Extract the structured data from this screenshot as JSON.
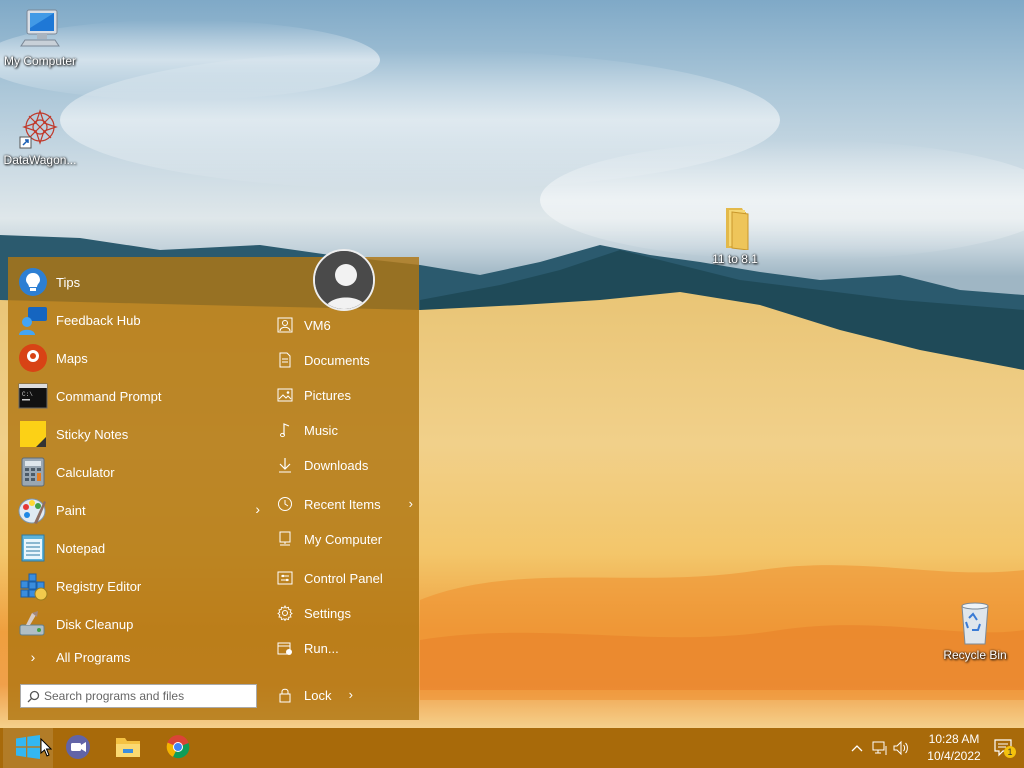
{
  "desktop": {
    "icons": [
      {
        "label": "My Computer",
        "icon": "monitor-icon"
      },
      {
        "label": "DataWagon...",
        "icon": "datawagon-shortcut-icon"
      },
      {
        "label": "11 to 8.1",
        "icon": "folder-icon"
      },
      {
        "label": "Recycle Bin",
        "icon": "recycle-bin-icon"
      }
    ]
  },
  "start_menu": {
    "left_items": [
      {
        "label": "Tips",
        "icon": "tips-icon"
      },
      {
        "label": "Feedback Hub",
        "icon": "feedback-hub-icon"
      },
      {
        "label": "Maps",
        "icon": "maps-icon"
      },
      {
        "label": "Command Prompt",
        "icon": "command-prompt-icon"
      },
      {
        "label": "Sticky Notes",
        "icon": "sticky-notes-icon"
      },
      {
        "label": "Calculator",
        "icon": "calculator-icon"
      },
      {
        "label": "Paint",
        "icon": "paint-icon"
      },
      {
        "label": "Notepad",
        "icon": "notepad-icon"
      },
      {
        "label": "Registry Editor",
        "icon": "registry-editor-icon"
      },
      {
        "label": "Disk Cleanup",
        "icon": "disk-cleanup-icon"
      }
    ],
    "all_programs": "All Programs",
    "search_placeholder": "Search programs and files",
    "right_items": [
      {
        "label": "VM6",
        "icon": "user-folder-icon"
      },
      {
        "label": "Documents",
        "icon": "documents-icon"
      },
      {
        "label": "Pictures",
        "icon": "pictures-icon"
      },
      {
        "label": "Music",
        "icon": "music-icon"
      },
      {
        "label": "Downloads",
        "icon": "downloads-icon"
      },
      {
        "label": "Recent Items",
        "icon": "clock-icon"
      },
      {
        "label": "My Computer",
        "icon": "computer-icon"
      },
      {
        "label": "Control Panel",
        "icon": "control-panel-icon"
      },
      {
        "label": "Settings",
        "icon": "gear-icon"
      },
      {
        "label": "Run...",
        "icon": "run-icon"
      }
    ],
    "lock": "Lock"
  },
  "taskbar": {
    "apps": [
      "start-button",
      "video-call-app",
      "file-explorer",
      "chrome"
    ],
    "time": "10:28 AM",
    "date": "10/4/2022",
    "notification_count": "1"
  },
  "colors": {
    "menu_bg": "#b07612",
    "taskbar_bg": "#a86a0a",
    "accent": "#0a84d8"
  }
}
